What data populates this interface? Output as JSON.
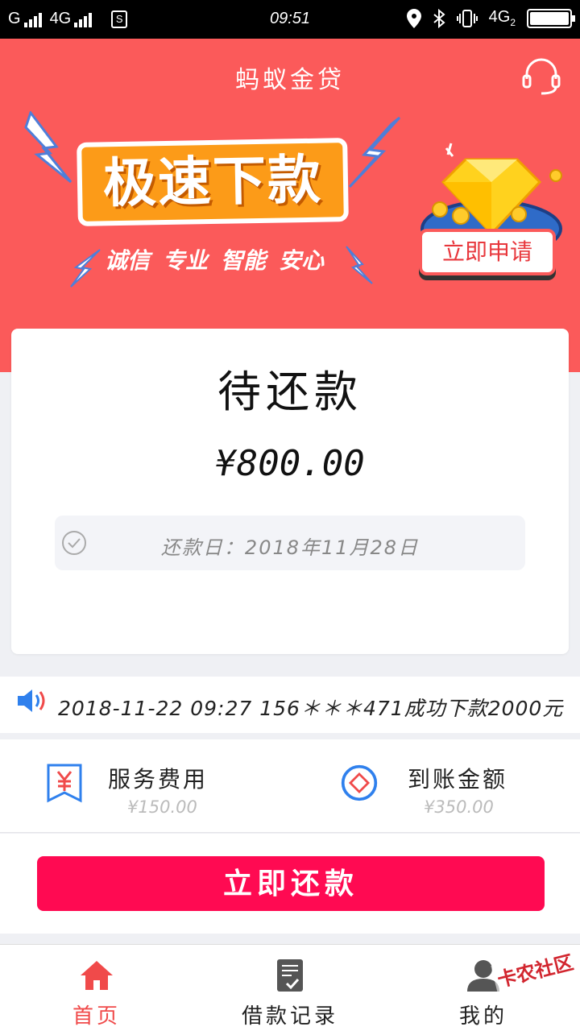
{
  "status_bar": {
    "carrier_1": "G",
    "carrier_2": "4G",
    "sim_icon": "S",
    "time": "09:51",
    "network": "4G",
    "network_sub": "2"
  },
  "header": {
    "title": "蚂蚁金贷",
    "support_icon": "headset-icon",
    "banner": {
      "headline": "极速下款",
      "tags": [
        "诚信",
        "专业",
        "智能",
        "安心"
      ],
      "apply_label": "立即申请"
    },
    "colors": {
      "header_bg": "#fb5a5a",
      "headline_bg": "#fc9b18"
    }
  },
  "repay_card": {
    "title": "待还款",
    "amount": "¥800.00",
    "due_date": "还款日：2018年11月28日",
    "check_icon": "check-circle-icon"
  },
  "notice": {
    "icon": "speaker-icon",
    "text": "2018-11-22 09:27 156＊＊＊471成功下款2000元"
  },
  "fees": [
    {
      "label": "服务费用",
      "value": "¥150.00",
      "icon": "yen-tag-icon"
    },
    {
      "label": "到账金额",
      "value": "¥350.00",
      "icon": "diamond-circle-icon"
    }
  ],
  "repay_button": {
    "label": "立即还款",
    "color": "#ff0a52"
  },
  "tab_bar": {
    "tabs": [
      {
        "label": "首页",
        "icon": "home-icon",
        "active": true
      },
      {
        "label": "借款记录",
        "icon": "records-icon",
        "active": false
      },
      {
        "label": "我的",
        "icon": "user-icon",
        "active": false
      }
    ]
  },
  "watermark": "卡农社区"
}
